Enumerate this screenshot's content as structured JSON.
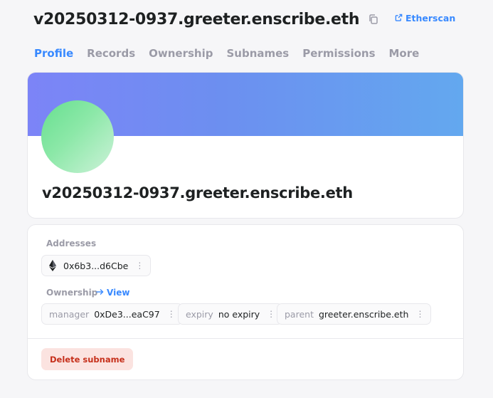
{
  "header": {
    "title": "v20250312-0937.greeter.enscribe.eth",
    "etherscan_label": "Etherscan"
  },
  "tabs": [
    {
      "label": "Profile",
      "active": true
    },
    {
      "label": "Records",
      "active": false
    },
    {
      "label": "Ownership",
      "active": false
    },
    {
      "label": "Subnames",
      "active": false
    },
    {
      "label": "Permissions",
      "active": false
    },
    {
      "label": "More",
      "active": false
    }
  ],
  "profile": {
    "name": "v20250312-0937.greeter.enscribe.eth"
  },
  "addresses": {
    "label": "Addresses",
    "items": [
      {
        "icon": "ethereum-icon",
        "value": "0x6b3...d6Cbe"
      }
    ]
  },
  "ownership": {
    "label": "Ownership",
    "view_label": "View",
    "items": [
      {
        "key": "manager",
        "value": "0xDe3...eaC97"
      },
      {
        "key": "expiry",
        "value": "no expiry"
      },
      {
        "key": "parent",
        "value": "greeter.enscribe.eth"
      }
    ]
  },
  "actions": {
    "delete_label": "Delete subname"
  },
  "colors": {
    "accent": "#3889ff",
    "danger": "#c6301b",
    "danger_bg": "#fbe3e0"
  }
}
